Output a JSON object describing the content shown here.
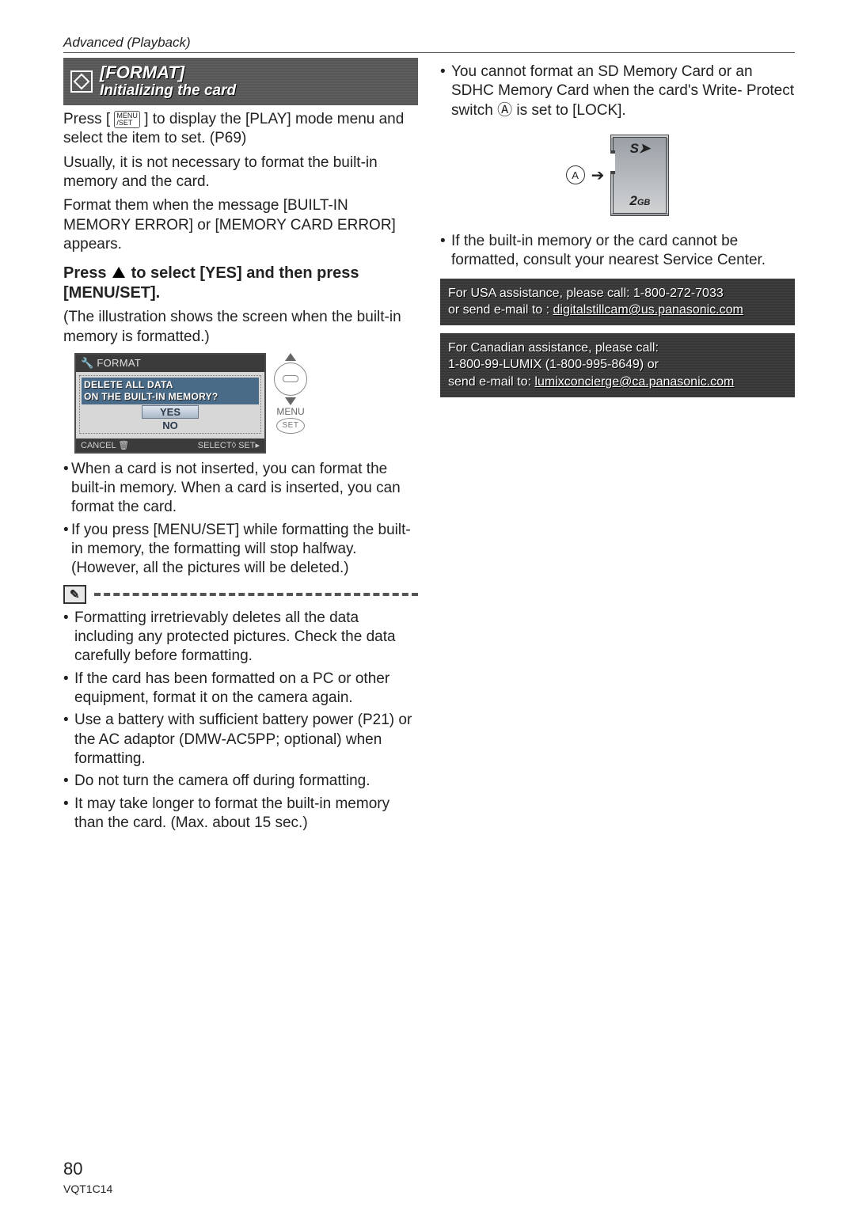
{
  "header": "Advanced (Playback)",
  "banner": {
    "title": "[FORMAT]",
    "subtitle": "Initializing the card"
  },
  "left": {
    "intro1": "Press [ ",
    "intro1b": " ] to display the [PLAY] mode menu and select the item to set. (P69)",
    "intro2": "Usually, it is not necessary to format the built-in memory and the card.",
    "intro3": "Format them when the message [BUILT-IN MEMORY ERROR] or [MEMORY CARD ERROR] appears.",
    "step_a": "Press ",
    "step_b": " to select [YES] and then press [MENU/SET].",
    "step_note": "(The illustration shows the screen when the built-in memory is formatted.)",
    "screen": {
      "title": "FORMAT",
      "line1": "DELETE ALL DATA",
      "line2": "ON THE BUILT-IN MEMORY?",
      "yes": "YES",
      "no": "NO",
      "cancel": "CANCEL",
      "select_left": "SELECT",
      "select_right": "SET",
      "menu": "MENU",
      "set": "SET"
    },
    "bullets_a": [
      "When a card is not inserted, you can format the built-in memory. When a card is inserted, you can format the card.",
      "If you press [MENU/SET] while formatting the built-in memory, the formatting will stop halfway. (However, all the pictures will be deleted.)"
    ],
    "note_icon": "✎",
    "bullets_b": [
      "Formatting irretrievably deletes all the data including any protected pictures. Check the data carefully before formatting.",
      "If the card has been formatted on a PC or other equipment, format it on the camera again.",
      "Use a battery with sufficient battery power (P21) or the AC adaptor (DMW-AC5PP; optional) when formatting.",
      "Do not turn the camera off during formatting.",
      "It may take longer to format the built-in memory than the card. (Max. about 15 sec.)"
    ]
  },
  "right": {
    "top_bullet": "You cannot format an SD Memory Card or an SDHC Memory Card when the card's Write- Protect switch Ⓐ is set to [LOCK].",
    "card": {
      "label_a": "A",
      "top": "S➤",
      "bottom": "2GB"
    },
    "bottom_bullet": "If the built-in memory or the card cannot be formatted, consult your nearest Service Center.",
    "assist_usa_a": "For USA assistance, please call: 1-800-272-7033",
    "assist_usa_b": "or send e-mail to : ",
    "assist_usa_email": "digitalstillcam@us.panasonic.com",
    "assist_can_a": "For Canadian assistance, please call:",
    "assist_can_b": "1-800-99-LUMIX (1-800-995-8649) or",
    "assist_can_c": "send e-mail to: ",
    "assist_can_email": "lumixconcierge@ca.panasonic.com"
  },
  "page_number": "80",
  "doc_id": "VQT1C14"
}
